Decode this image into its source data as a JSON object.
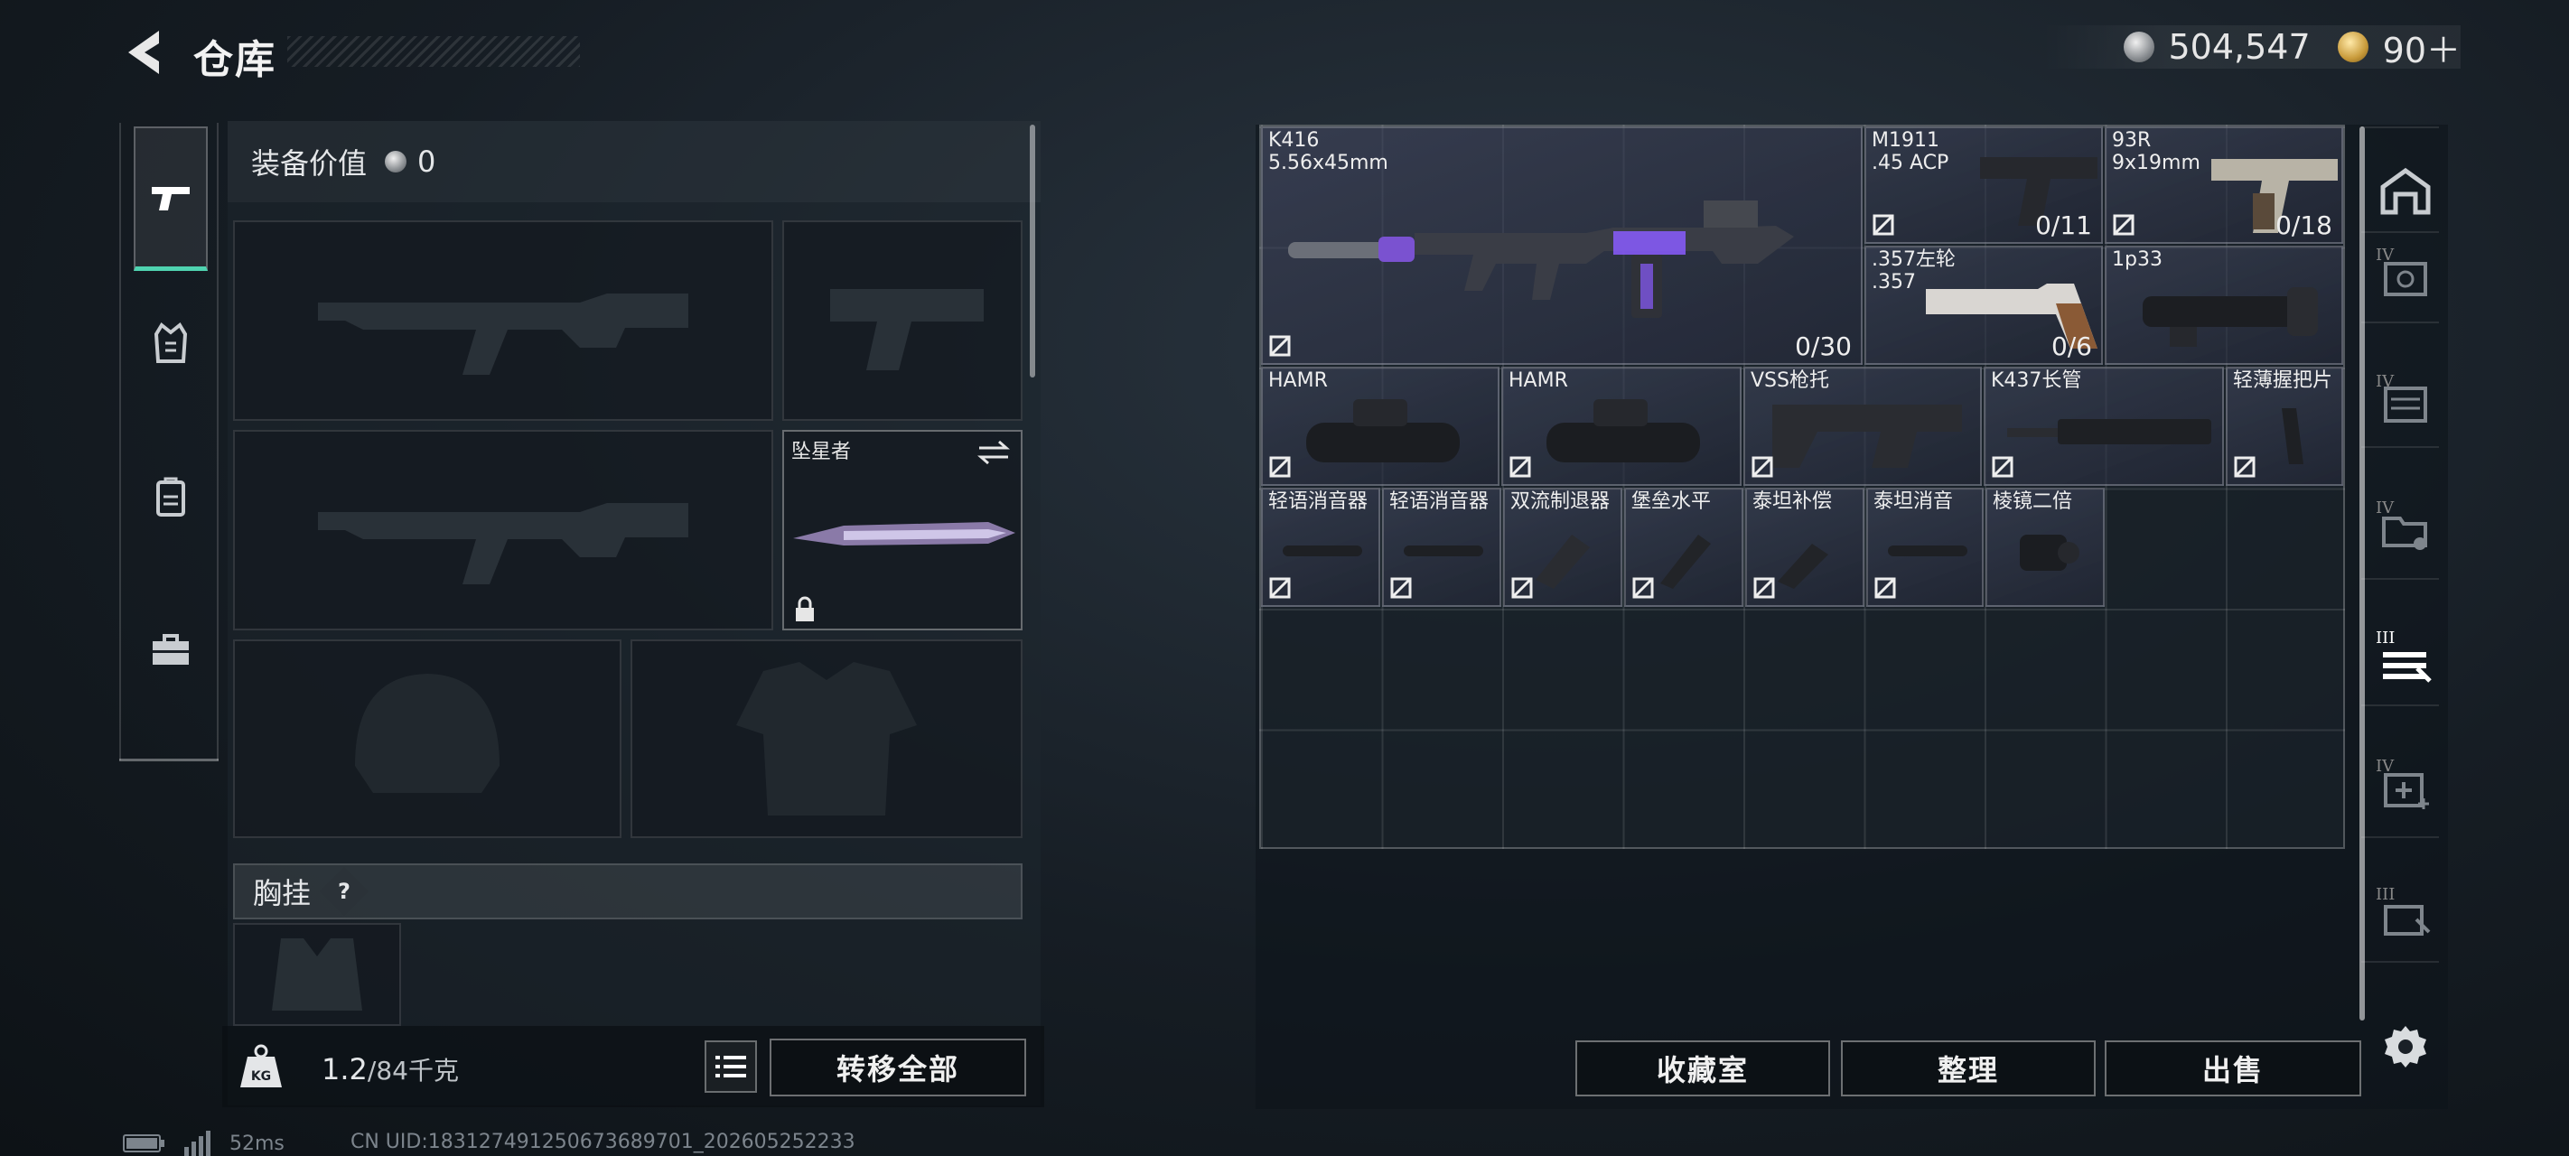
{
  "header": {
    "title": "仓库"
  },
  "currency": {
    "silver": "504,547",
    "gold": "90＋"
  },
  "loadout": {
    "equip_value_label": "装备价值",
    "equip_value": "0",
    "melee_name": "坠星者",
    "chest_label": "胸挂",
    "chest_help": "?",
    "weight_current": "1.2",
    "weight_max": "/84千克",
    "transfer_all": "转移全部"
  },
  "warehouse": {
    "items": [
      {
        "name": "K416",
        "sub": "5.56x45mm",
        "count": "0/30"
      },
      {
        "name": "M1911",
        "sub": ".45 ACP",
        "count": "0/11"
      },
      {
        "name": "93R",
        "sub": "9x19mm",
        "count": "0/18"
      },
      {
        "name": ".357左轮",
        "sub": ".357",
        "count": "0/6"
      },
      {
        "name": "1p33",
        "sub": ""
      },
      {
        "name": "HAMR"
      },
      {
        "name": "HAMR"
      },
      {
        "name": "VSS枪托"
      },
      {
        "name": "K437长管"
      },
      {
        "name": "轻薄握把片"
      },
      {
        "name": "轻语消音器"
      },
      {
        "name": "轻语消音器"
      },
      {
        "name": "双流制退器"
      },
      {
        "name": "堡垒水平"
      },
      {
        "name": "泰坦补偿"
      },
      {
        "name": "泰坦消音"
      },
      {
        "name": "棱镜二倍"
      }
    ],
    "buttons": {
      "collection": "收藏室",
      "sort": "整理",
      "sell": "出售"
    }
  },
  "right_rail": {
    "tiers": [
      "IV",
      "IV",
      "IV",
      "III",
      "IV",
      "III"
    ]
  },
  "status": {
    "ping": "52ms",
    "uid": "CN UID:18312749125067368970​1_202605252233"
  },
  "colors": {
    "accent": "#4fd3b0",
    "purple": "#8a5cff"
  }
}
